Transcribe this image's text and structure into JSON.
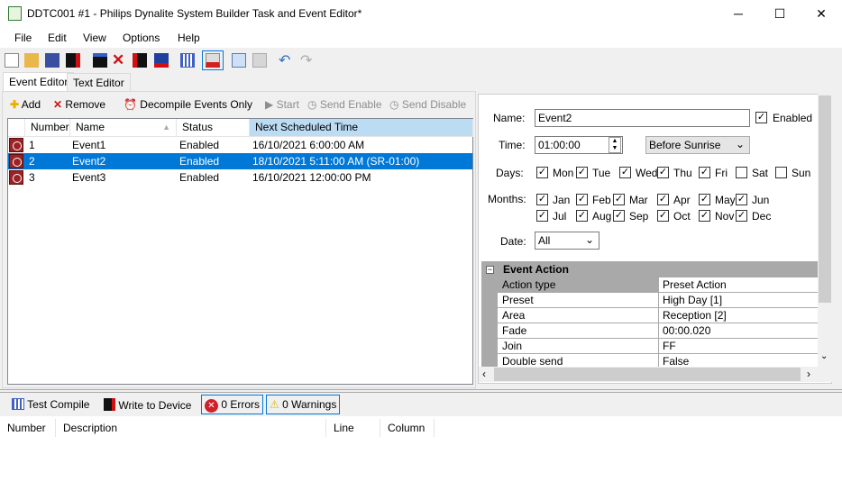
{
  "window": {
    "title": "DDTC001 #1 - Philips Dynalite System Builder Task and Event Editor*",
    "minimize": "─",
    "maximize": "☐",
    "close": "✕"
  },
  "menu": [
    "File",
    "Edit",
    "View",
    "Options",
    "Help"
  ],
  "toolbar_icons": [
    "new-icon",
    "open-icon",
    "save-icon",
    "write-device-icon",
    "decompile-icon",
    "delete-icon",
    "copy-device-icon",
    "paste-device-icon",
    "compile-icon",
    "clear-icon",
    "copy-icon",
    "paste-icon",
    "undo-icon",
    "redo-icon"
  ],
  "tabs": [
    {
      "label": "Event Editor",
      "active": true
    },
    {
      "label": "Text Editor",
      "active": false
    }
  ],
  "event_toolbar": {
    "add": "Add",
    "remove": "Remove",
    "decompile": "Decompile Events Only",
    "start": "Start",
    "send_enable": "Send Enable",
    "send_disable": "Send Disable"
  },
  "grid": {
    "columns": [
      "Number",
      "Name",
      "Status",
      "Next Scheduled Time"
    ],
    "rows": [
      {
        "number": "1",
        "name": "Event1",
        "status": "Enabled",
        "next": "16/10/2021 6:00:00 AM",
        "selected": false
      },
      {
        "number": "2",
        "name": "Event2",
        "status": "Enabled",
        "next": "18/10/2021 5:11:00 AM (SR-01:00)",
        "selected": true
      },
      {
        "number": "3",
        "name": "Event3",
        "status": "Enabled",
        "next": "16/10/2021 12:00:00 PM",
        "selected": false
      }
    ]
  },
  "details": {
    "name_label": "Name:",
    "name_value": "Event2",
    "enabled_label": "Enabled",
    "enabled": true,
    "time_label": "Time:",
    "time_value": "01:00:00",
    "time_mode": "Before Sunrise",
    "days_label": "Days:",
    "days": [
      {
        "l": "Mon",
        "c": true
      },
      {
        "l": "Tue",
        "c": true
      },
      {
        "l": "Wed",
        "c": true
      },
      {
        "l": "Thu",
        "c": true
      },
      {
        "l": "Fri",
        "c": true
      },
      {
        "l": "Sat",
        "c": false
      },
      {
        "l": "Sun",
        "c": false
      }
    ],
    "months_label": "Months:",
    "months": [
      {
        "l": "Jan",
        "c": true
      },
      {
        "l": "Feb",
        "c": true
      },
      {
        "l": "Mar",
        "c": true
      },
      {
        "l": "Apr",
        "c": true
      },
      {
        "l": "May",
        "c": true
      },
      {
        "l": "Jun",
        "c": true
      },
      {
        "l": "Jul",
        "c": true
      },
      {
        "l": "Aug",
        "c": true
      },
      {
        "l": "Sep",
        "c": true
      },
      {
        "l": "Oct",
        "c": true
      },
      {
        "l": "Nov",
        "c": true
      },
      {
        "l": "Dec",
        "c": true
      }
    ],
    "date_label": "Date:",
    "date_value": "All"
  },
  "property_grid": {
    "category": "Event Action",
    "rows": [
      [
        "Action type",
        "Preset Action"
      ],
      [
        "Preset",
        "High Day [1]"
      ],
      [
        "Area",
        "Reception [2]"
      ],
      [
        "Fade",
        "00:00.020"
      ],
      [
        "Join",
        "FF"
      ],
      [
        "Double send",
        "False"
      ]
    ]
  },
  "bottom_toolbar": {
    "test_compile": "Test Compile",
    "write": "Write to Device",
    "errors": "0 Errors",
    "warnings": "0 Warnings"
  },
  "bottom_columns": [
    "Number",
    "Description",
    "Line",
    "Column"
  ],
  "colors": {
    "selection": "#0078d7",
    "sorted_header": "#bcdcf4",
    "clock_icon": "#9b2226"
  }
}
